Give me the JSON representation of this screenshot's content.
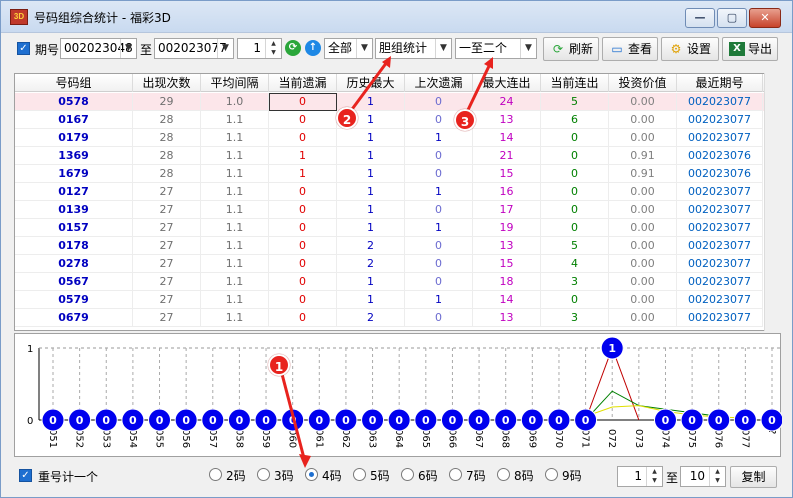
{
  "window": {
    "title": "号码组综合统计 - 福彩3D",
    "icon_text": "3D",
    "minimize": "—",
    "maximize": "▢",
    "close": "✕"
  },
  "toolbar": {
    "period_checkbox_label": "期号",
    "period_start": "002023048",
    "to_label": "至",
    "period_end": "002023077",
    "step_value": "1",
    "filter_all": "全部",
    "stat_type": "胆组统计",
    "range_type": "一至二个",
    "refresh_label": "刷新",
    "view_label": "查看",
    "settings_label": "设置",
    "export_label": "导出"
  },
  "table": {
    "columns": [
      "号码组",
      "出现次数",
      "平均间隔",
      "当前遗漏",
      "历史最大",
      "上次遗漏",
      "最大连出",
      "当前连出",
      "投资价值",
      "最近期号"
    ],
    "rows": [
      [
        "0578",
        "29",
        "1.0",
        "0",
        "1",
        "0",
        "24",
        "5",
        "0.00",
        "002023077"
      ],
      [
        "0167",
        "28",
        "1.1",
        "0",
        "1",
        "0",
        "13",
        "6",
        "0.00",
        "002023077"
      ],
      [
        "0179",
        "28",
        "1.1",
        "0",
        "1",
        "1",
        "14",
        "0",
        "0.00",
        "002023077"
      ],
      [
        "1369",
        "28",
        "1.1",
        "1",
        "1",
        "0",
        "21",
        "0",
        "0.91",
        "002023076"
      ],
      [
        "1679",
        "28",
        "1.1",
        "1",
        "1",
        "0",
        "15",
        "0",
        "0.91",
        "002023076"
      ],
      [
        "0127",
        "27",
        "1.1",
        "0",
        "1",
        "1",
        "16",
        "0",
        "0.00",
        "002023077"
      ],
      [
        "0139",
        "27",
        "1.1",
        "0",
        "1",
        "0",
        "17",
        "0",
        "0.00",
        "002023077"
      ],
      [
        "0157",
        "27",
        "1.1",
        "0",
        "1",
        "1",
        "19",
        "0",
        "0.00",
        "002023077"
      ],
      [
        "0178",
        "27",
        "1.1",
        "0",
        "2",
        "0",
        "13",
        "5",
        "0.00",
        "002023077"
      ],
      [
        "0278",
        "27",
        "1.1",
        "0",
        "2",
        "0",
        "15",
        "4",
        "0.00",
        "002023077"
      ],
      [
        "0567",
        "27",
        "1.1",
        "0",
        "1",
        "0",
        "18",
        "3",
        "0.00",
        "002023077"
      ],
      [
        "0579",
        "27",
        "1.1",
        "0",
        "1",
        "1",
        "14",
        "0",
        "0.00",
        "002023077"
      ],
      [
        "0679",
        "27",
        "1.1",
        "0",
        "2",
        "0",
        "13",
        "3",
        "0.00",
        "002023077"
      ]
    ]
  },
  "chart_data": {
    "type": "line",
    "x": [
      "051",
      "052",
      "053",
      "054",
      "055",
      "056",
      "057",
      "058",
      "059",
      "060",
      "061",
      "062",
      "063",
      "064",
      "065",
      "066",
      "067",
      "068",
      "069",
      "070",
      "071",
      "072",
      "073",
      "074",
      "075",
      "076",
      "077",
      "?"
    ],
    "series": [
      {
        "values": [
          0,
          0,
          0,
          0,
          0,
          0,
          0,
          0,
          0,
          0,
          0,
          0,
          0,
          0,
          0,
          0,
          0,
          0,
          0,
          0,
          0,
          1,
          0,
          0,
          0,
          0,
          0,
          0
        ]
      }
    ],
    "ylim": [
      0,
      1
    ],
    "y_ticks": [
      "0",
      "1"
    ],
    "grid": true,
    "colors": {
      "points": "#0000ee",
      "line": "#c00000",
      "ma1": "#008000",
      "ma2": "#e0e000"
    }
  },
  "bottom": {
    "repeat_label": "重号计一个",
    "radios": [
      "2码",
      "3码",
      "4码",
      "5码",
      "6码",
      "7码",
      "8码",
      "9码"
    ],
    "selected_radio": 2,
    "from_value": "1",
    "to_label": "至",
    "to_value": "10",
    "copy_label": "复制"
  },
  "callouts": [
    "1",
    "2",
    "3"
  ]
}
